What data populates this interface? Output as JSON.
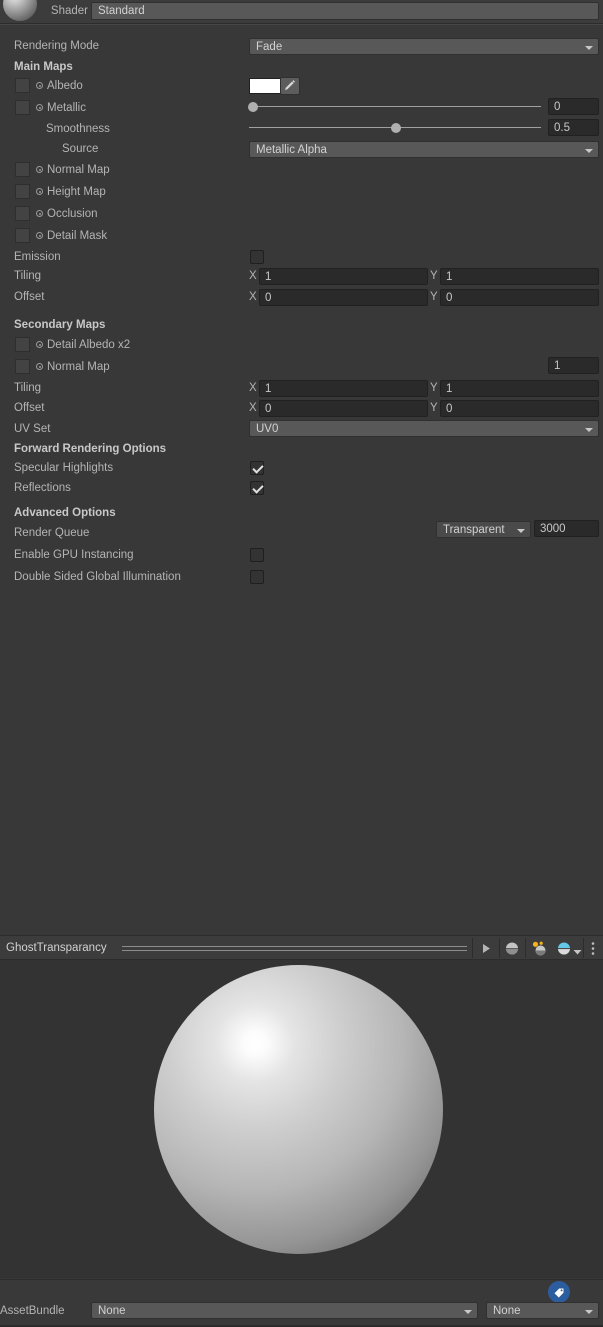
{
  "shader_row": {
    "label": "Shader",
    "value": "Standard",
    "icon": "material-preview-sphere-icon"
  },
  "properties": {
    "rendering_mode": {
      "label": "Rendering Mode",
      "value": "Fade"
    },
    "main_maps_header": "Main Maps",
    "albedo": {
      "label": "Albedo",
      "color": "#ffffff",
      "eyedropper_icon": "eyedropper-icon"
    },
    "metallic": {
      "label": "Metallic",
      "value": "0",
      "slider_fraction": 0
    },
    "smoothness": {
      "label": "Smoothness",
      "value": "0.5",
      "slider_fraction": 0.5
    },
    "source": {
      "label": "Source",
      "value": "Metallic Alpha"
    },
    "normal_map": {
      "label": "Normal Map"
    },
    "height_map": {
      "label": "Height Map"
    },
    "occlusion": {
      "label": "Occlusion"
    },
    "detail_mask": {
      "label": "Detail Mask"
    },
    "emission": {
      "label": "Emission",
      "checked": false
    },
    "tiling": {
      "label": "Tiling",
      "x_prefix": "X",
      "x": "1",
      "y_prefix": "Y",
      "y": "1"
    },
    "offset": {
      "label": "Offset",
      "x_prefix": "X",
      "x": "0",
      "y_prefix": "Y",
      "y": "0"
    },
    "secondary_maps_header": "Secondary Maps",
    "detail_albedo": {
      "label": "Detail Albedo x2"
    },
    "secondary_normal_map": {
      "label": "Normal Map",
      "value": "1"
    },
    "secondary_tiling": {
      "label": "Tiling",
      "x_prefix": "X",
      "x": "1",
      "y_prefix": "Y",
      "y": "1"
    },
    "secondary_offset": {
      "label": "Offset",
      "x_prefix": "X",
      "x": "0",
      "y_prefix": "Y",
      "y": "0"
    },
    "uv_set": {
      "label": "UV Set",
      "value": "UV0"
    },
    "forward_rendering_header": "Forward Rendering Options",
    "specular_highlights": {
      "label": "Specular Highlights",
      "checked": true
    },
    "reflections": {
      "label": "Reflections",
      "checked": true
    },
    "advanced_options_header": "Advanced Options",
    "render_queue": {
      "label": "Render Queue",
      "preset": "Transparent",
      "value": "3000"
    },
    "gpu_instancing": {
      "label": "Enable GPU Instancing",
      "checked": false
    },
    "double_sided_gi": {
      "label": "Double Sided Global Illumination",
      "checked": false
    }
  },
  "preview": {
    "title": "GhostTransparancy",
    "drag_handle": "drag-handle",
    "toolbar": {
      "play_icon": "play-icon",
      "mesh_icon": "sphere-mesh-icon",
      "lighting_icon": "lighting-icon",
      "environment_icon": "environment-sphere-icon",
      "environment_dropdown_icon": "chevron-down-icon",
      "overflow_icon": "kebab-menu-icon"
    }
  },
  "asset_bundle": {
    "label": "AssetBundle",
    "bundle_value": "None",
    "variant_value": "None",
    "tag_icon": "tag-icon"
  }
}
